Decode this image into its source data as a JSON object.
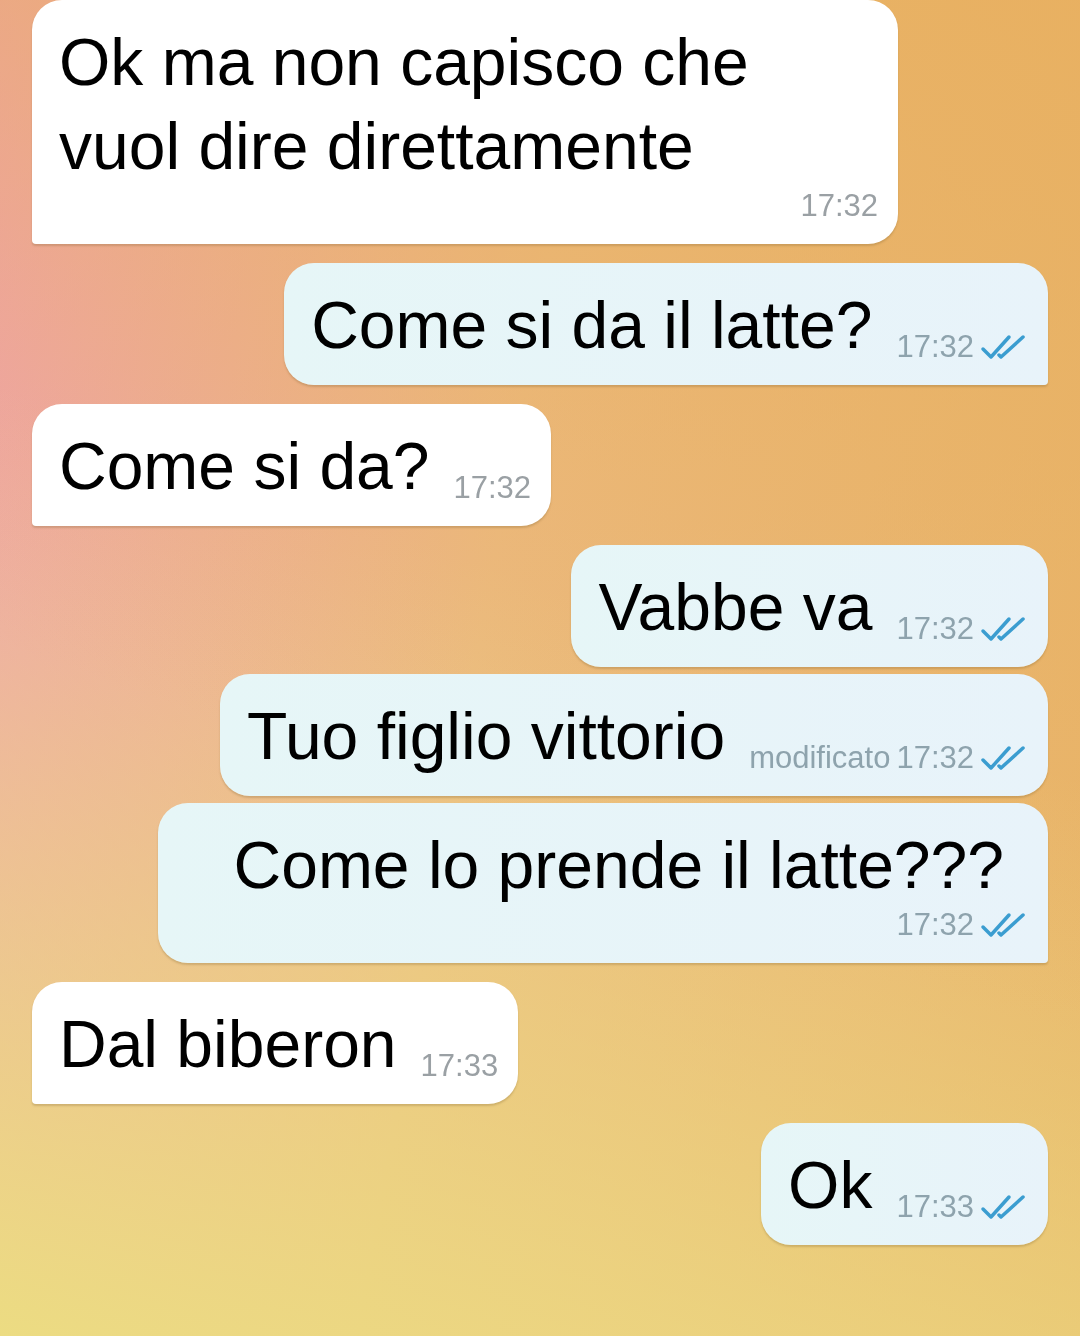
{
  "messages": [
    {
      "kind": "incoming",
      "text": "Ok ma non capisco che vuol dire direttamente",
      "time": "17:32",
      "tail": true
    },
    {
      "kind": "outgoing",
      "text": "Come si da il latte?",
      "time": "17:32",
      "read": true,
      "tail": true
    },
    {
      "kind": "incoming",
      "text": "Come si da?",
      "time": "17:32",
      "tail": true
    },
    {
      "kind": "outgoing",
      "text": "Vabbe va",
      "time": "17:32",
      "read": true,
      "tail": false
    },
    {
      "kind": "outgoing",
      "text": "Tuo figlio vittorio",
      "edited": "modificato",
      "time": "17:32",
      "read": true,
      "tail": false
    },
    {
      "kind": "outgoing",
      "text": "Come lo prende il latte???",
      "time": "17:32",
      "read": true,
      "tail": true
    },
    {
      "kind": "incoming",
      "text": "Dal biberon",
      "time": "17:33",
      "tail": true
    },
    {
      "kind": "outgoing",
      "text": "Ok",
      "time": "17:33",
      "read": true,
      "tail": false
    }
  ]
}
